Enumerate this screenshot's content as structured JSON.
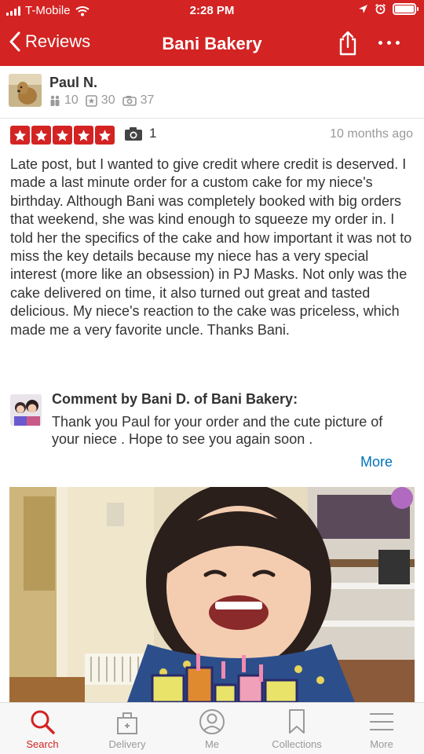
{
  "status_bar": {
    "carrier": "T-Mobile",
    "time": "2:28 PM",
    "icons": [
      "signal-icon",
      "wifi-icon",
      "location-arrow-icon",
      "alarm-icon",
      "battery-icon"
    ]
  },
  "nav": {
    "back_label": "Reviews",
    "title": "Bani Bakery",
    "icons": [
      "chevron-left-icon",
      "share-icon",
      "more-dots-icon"
    ]
  },
  "user": {
    "name": "Paul N.",
    "friends": "10",
    "reviews": "30",
    "photos": "37"
  },
  "review": {
    "rating": 5,
    "photo_count": "1",
    "date": "10 months ago",
    "text": "Late post, but I wanted to give credit where credit is deserved. I made a last minute order for a custom cake for my niece's birthday. Although Bani was completely booked with big orders that weekend, she was kind enough to squeeze my order in. I told her the specifics of the cake and how important it was not to miss the key details because my niece has a very special interest (more like an obsession) in PJ Masks. Not only was the cake delivered on time, it also turned out great and tasted delicious. My niece's reaction to the cake was priceless, which made me a very favorite uncle. Thanks Bani."
  },
  "comment": {
    "heading": "Comment by Bani D. of Bani Bakery:",
    "text": "Thank you Paul for your order and the cute picture of your niece . Hope to see you again soon .",
    "more_label": "More"
  },
  "tabs": [
    {
      "label": "Search",
      "icon": "search-icon",
      "active": true
    },
    {
      "label": "Delivery",
      "icon": "delivery-bag-icon",
      "active": false
    },
    {
      "label": "Me",
      "icon": "user-icon",
      "active": false
    },
    {
      "label": "Collections",
      "icon": "bookmark-icon",
      "active": false
    },
    {
      "label": "More",
      "icon": "menu-icon",
      "active": false
    }
  ],
  "colors": {
    "brand_red": "#d32323",
    "link_blue": "#0073bb",
    "muted_gray": "#999999"
  }
}
